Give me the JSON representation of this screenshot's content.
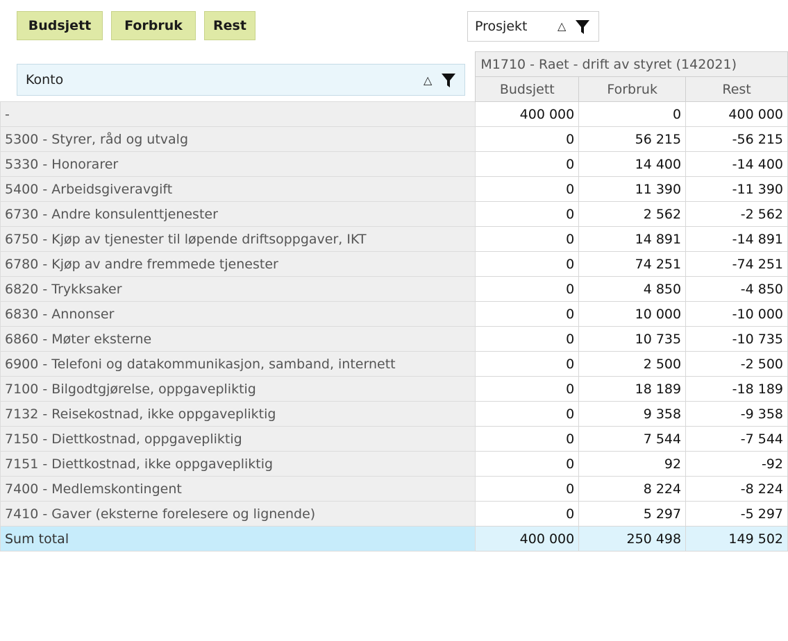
{
  "value_fields": [
    {
      "label": "Budsjett"
    },
    {
      "label": "Forbruk"
    },
    {
      "label": "Rest"
    }
  ],
  "column_field": {
    "label": "Prosjekt",
    "sort_icon": "sort-triangle-icon",
    "filter_icon": "funnel-filter-icon"
  },
  "row_field": {
    "label": "Konto",
    "sort_icon": "sort-triangle-icon",
    "filter_icon": "funnel-filter-icon"
  },
  "project": {
    "label": "M1710 - Raet - drift av styret (142021)"
  },
  "columns": [
    "Budsjett",
    "Forbruk",
    "Rest"
  ],
  "rows": [
    {
      "konto": "-",
      "budsjett": "400 000",
      "forbruk": "0",
      "rest": "400 000"
    },
    {
      "konto": "5300 - Styrer, råd og utvalg",
      "budsjett": "0",
      "forbruk": "56 215",
      "rest": "-56 215"
    },
    {
      "konto": "5330 - Honorarer",
      "budsjett": "0",
      "forbruk": "14 400",
      "rest": "-14 400"
    },
    {
      "konto": "5400 - Arbeidsgiveravgift",
      "budsjett": "0",
      "forbruk": "11 390",
      "rest": "-11 390"
    },
    {
      "konto": "6730 - Andre konsulenttjenester",
      "budsjett": "0",
      "forbruk": "2 562",
      "rest": "-2 562"
    },
    {
      "konto": "6750 - Kjøp av tjenester til løpende driftsoppgaver, IKT",
      "budsjett": "0",
      "forbruk": "14 891",
      "rest": "-14 891"
    },
    {
      "konto": "6780 - Kjøp av andre fremmede tjenester",
      "budsjett": "0",
      "forbruk": "74 251",
      "rest": "-74 251"
    },
    {
      "konto": "6820 - Trykksaker",
      "budsjett": "0",
      "forbruk": "4 850",
      "rest": "-4 850"
    },
    {
      "konto": "6830 - Annonser",
      "budsjett": "0",
      "forbruk": "10 000",
      "rest": "-10 000"
    },
    {
      "konto": "6860 - Møter eksterne",
      "budsjett": "0",
      "forbruk": "10 735",
      "rest": "-10 735"
    },
    {
      "konto": "6900 - Telefoni og datakommunikasjon, samband, internett",
      "budsjett": "0",
      "forbruk": "2 500",
      "rest": "-2 500"
    },
    {
      "konto": "7100 - Bilgodtgjørelse, oppgavepliktig",
      "budsjett": "0",
      "forbruk": "18 189",
      "rest": "-18 189"
    },
    {
      "konto": "7132 - Reisekostnad, ikke oppgavepliktig",
      "budsjett": "0",
      "forbruk": "9 358",
      "rest": "-9 358"
    },
    {
      "konto": "7150 - Diettkostnad, oppgavepliktig",
      "budsjett": "0",
      "forbruk": "7 544",
      "rest": "-7 544"
    },
    {
      "konto": "7151 - Diettkostnad, ikke oppgavepliktig",
      "budsjett": "0",
      "forbruk": "92",
      "rest": "-92"
    },
    {
      "konto": "7400 - Medlemskontingent",
      "budsjett": "0",
      "forbruk": "8 224",
      "rest": "-8 224"
    },
    {
      "konto": "7410 - Gaver (eksterne forelesere og lignende)",
      "budsjett": "0",
      "forbruk": "5 297",
      "rest": "-5 297"
    }
  ],
  "total": {
    "label": "Sum total",
    "budsjett": "400 000",
    "forbruk": "250 498",
    "rest": "149 502"
  },
  "colors": {
    "chip": "#dfe9a6",
    "header": "#efefef",
    "row_field": "#eaf6fb",
    "total_label": "#c7ecfb",
    "total_value": "#ddf3fc"
  }
}
